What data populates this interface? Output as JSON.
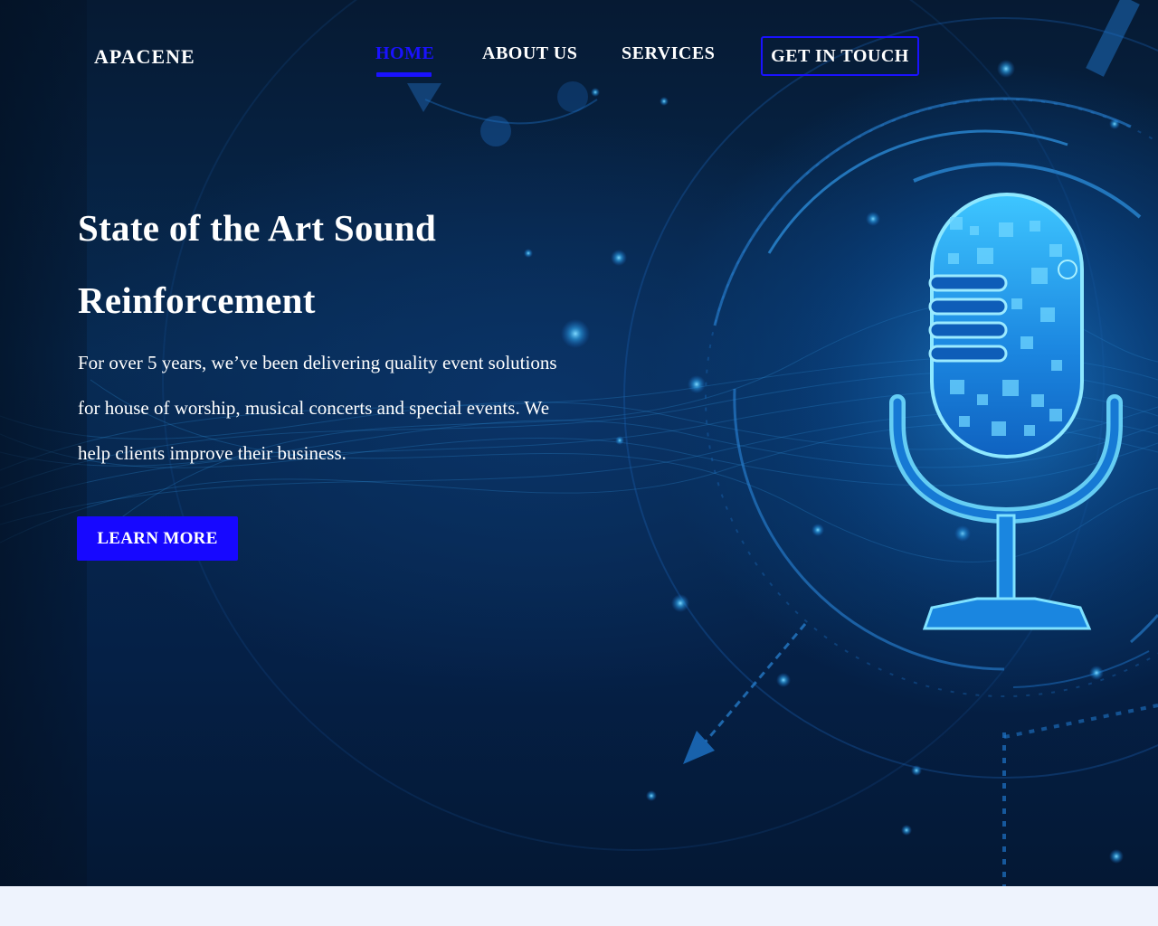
{
  "brand": {
    "logo_text": "APACENE"
  },
  "nav": {
    "items": [
      {
        "label": "HOME",
        "active": true
      },
      {
        "label": "ABOUT US",
        "active": false
      },
      {
        "label": "SERVICES",
        "active": false
      }
    ],
    "contact_label": "GET IN TOUCH"
  },
  "hero": {
    "headline": "State of the Art Sound Reinforcement",
    "description": "For over 5 years, we’ve been delivering quality event solutions for house of worship, musical concerts and special events. We help clients improve their business.",
    "cta_label": "LEARN MORE",
    "illustration_icon": "microphone-icon"
  },
  "colors": {
    "accent": "#1708ff",
    "nav_active": "#1a12ff",
    "hero_background": "#06234a",
    "mic_glow": "#5fd8ff",
    "page_background": "#eef3fd"
  }
}
